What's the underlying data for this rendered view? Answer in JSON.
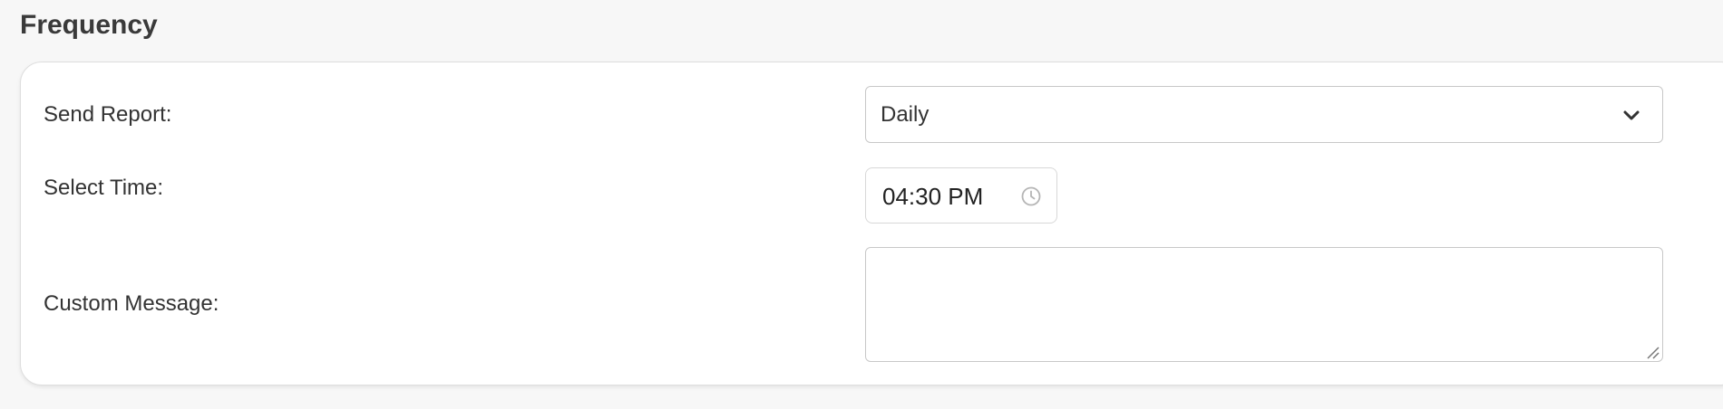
{
  "section": {
    "title": "Frequency"
  },
  "form": {
    "send_report": {
      "label": "Send Report:",
      "value": "Daily"
    },
    "select_time": {
      "label": "Select Time:",
      "value": "04:30 PM"
    },
    "custom_message": {
      "label": "Custom Message:",
      "value": ""
    }
  },
  "icons": {
    "select_chevron": "chevron-down-icon",
    "time_clock": "clock-icon",
    "textarea_resize": "resize-handle-icon"
  },
  "colors": {
    "page_background": "#f7f7f7",
    "card_background": "#ffffff",
    "border": "#c8c8c8",
    "text": "#333333"
  }
}
